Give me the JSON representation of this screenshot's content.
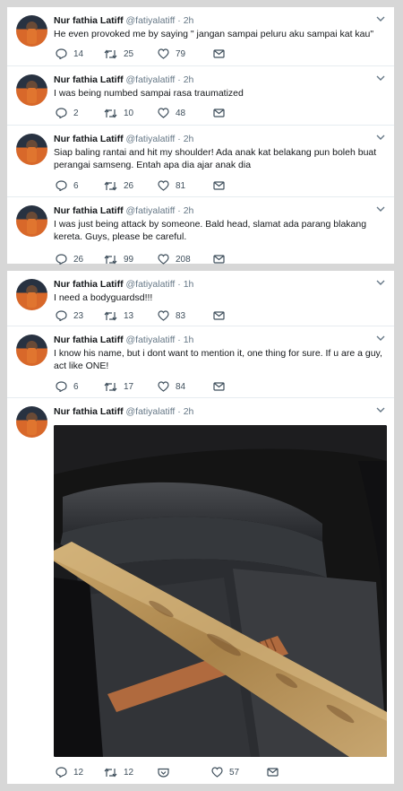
{
  "tweets_top": [
    {
      "name": "Nur fathia Latiff",
      "handle": "@fatiyalatiff",
      "time": "2h",
      "text": "He even provoked me by saying \" jangan sampai peluru aku sampai kat kau\"",
      "replies": "14",
      "retweets": "25",
      "likes": "79"
    },
    {
      "name": "Nur fathia Latiff",
      "handle": "@fatiyalatiff",
      "time": "2h",
      "text": "I was being numbed sampai rasa traumatized",
      "replies": "2",
      "retweets": "10",
      "likes": "48"
    },
    {
      "name": "Nur fathia Latiff",
      "handle": "@fatiyalatiff",
      "time": "2h",
      "text": "Siap baling rantai and hit my shoulder! Ada anak kat belakang pun boleh buat perangai samseng. Entah apa dia ajar anak dia",
      "replies": "6",
      "retweets": "26",
      "likes": "81"
    },
    {
      "name": "Nur fathia Latiff",
      "handle": "@fatiyalatiff",
      "time": "2h",
      "text": "I was just being attack by someone. Bald head, slamat ada parang blakang kereta. Guys, please be careful.",
      "replies": "26",
      "retweets": "99",
      "likes": "208"
    }
  ],
  "tweets_bottom": [
    {
      "name": "Nur fathia Latiff",
      "handle": "@fatiyalatiff",
      "time": "1h",
      "text": "I need a bodyguardsd!!!",
      "replies": "23",
      "retweets": "13",
      "likes": "83"
    },
    {
      "name": "Nur fathia Latiff",
      "handle": "@fatiyalatiff",
      "time": "1h",
      "text": "I know his name, but i dont want to mention it, one thing for sure. If u are a guy, act like ONE!",
      "replies": "6",
      "retweets": "17",
      "likes": "84"
    },
    {
      "name": "Nur fathia Latiff",
      "handle": "@fatiyalatiff",
      "time": "2h",
      "text": "",
      "replies": "12",
      "retweets": "12",
      "likes": "57"
    }
  ],
  "separator": "·",
  "colors": {
    "icon": "#3f4f5c",
    "muted": "#657786",
    "text": "#14171a",
    "divider": "#e6ecf0",
    "background": "#d7d7d7"
  },
  "icons": [
    "reply-icon",
    "retweet-icon",
    "like-icon",
    "direct-message-icon",
    "analytics-icon",
    "chevron-down-icon"
  ]
}
